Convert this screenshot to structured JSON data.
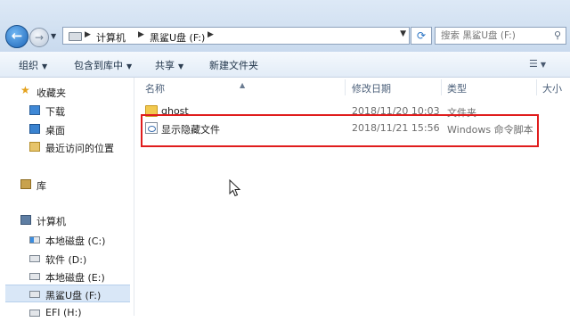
{
  "address": {
    "crumbs": [
      "计算机",
      "黑鲨U盘 (F:)"
    ],
    "search_placeholder": "搜索 黑鲨U盘 (F:)"
  },
  "toolbar": {
    "organize": "组织",
    "include_library": "包含到库中",
    "share": "共享",
    "new_folder": "新建文件夹"
  },
  "sidebar": {
    "favorites": "收藏夹",
    "downloads": "下载",
    "desktop": "桌面",
    "recent": "最近访问的位置",
    "libraries": "库",
    "computer": "计算机",
    "drive_c": "本地磁盘 (C:)",
    "drive_d": "软件 (D:)",
    "drive_e": "本地磁盘 (E:)",
    "drive_f": "黑鲨U盘 (F:)",
    "drive_h": "EFI (H:)"
  },
  "columns": {
    "name": "名称",
    "date": "修改日期",
    "type": "类型",
    "size": "大小"
  },
  "files": [
    {
      "name": "ghost",
      "date": "2018/11/20 10:03",
      "type": "文件夹",
      "icon": "folder-icon"
    },
    {
      "name": "显示隐藏文件",
      "date": "2018/11/21 15:56",
      "type": "Windows 命令脚本",
      "icon": "script-icon"
    }
  ],
  "colors": {
    "highlight_border": "#e01d1d",
    "selection": "#d9e7f7"
  }
}
